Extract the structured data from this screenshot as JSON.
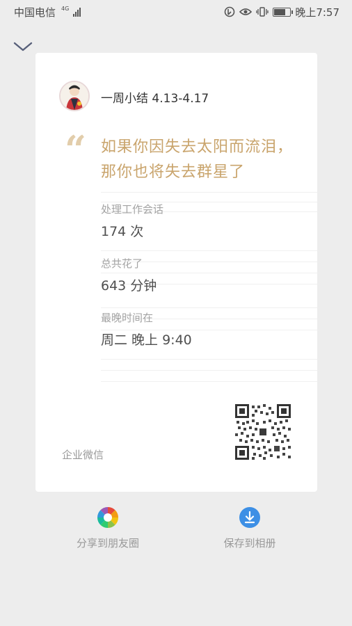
{
  "status_bar": {
    "carrier": "中国电信",
    "network": "4G",
    "time": "晚上7:57"
  },
  "card": {
    "title": "一周小结 4.13-4.17",
    "quote": "如果你因失去太阳而流泪，那你也将失去群星了",
    "stats": [
      {
        "label": "处理工作会话",
        "value": "174 次"
      },
      {
        "label": "总共花了",
        "value": "643 分钟"
      },
      {
        "label": "最晚时间在",
        "value": "周二 晚上 9:40"
      }
    ],
    "brand": "企业微信"
  },
  "actions": {
    "share_label": "分享到朋友圈",
    "save_label": "保存到相册"
  },
  "colors": {
    "quote": "#c9a46c",
    "quote_mark": "#e2cdab",
    "save_icon": "#3d8fe5"
  }
}
